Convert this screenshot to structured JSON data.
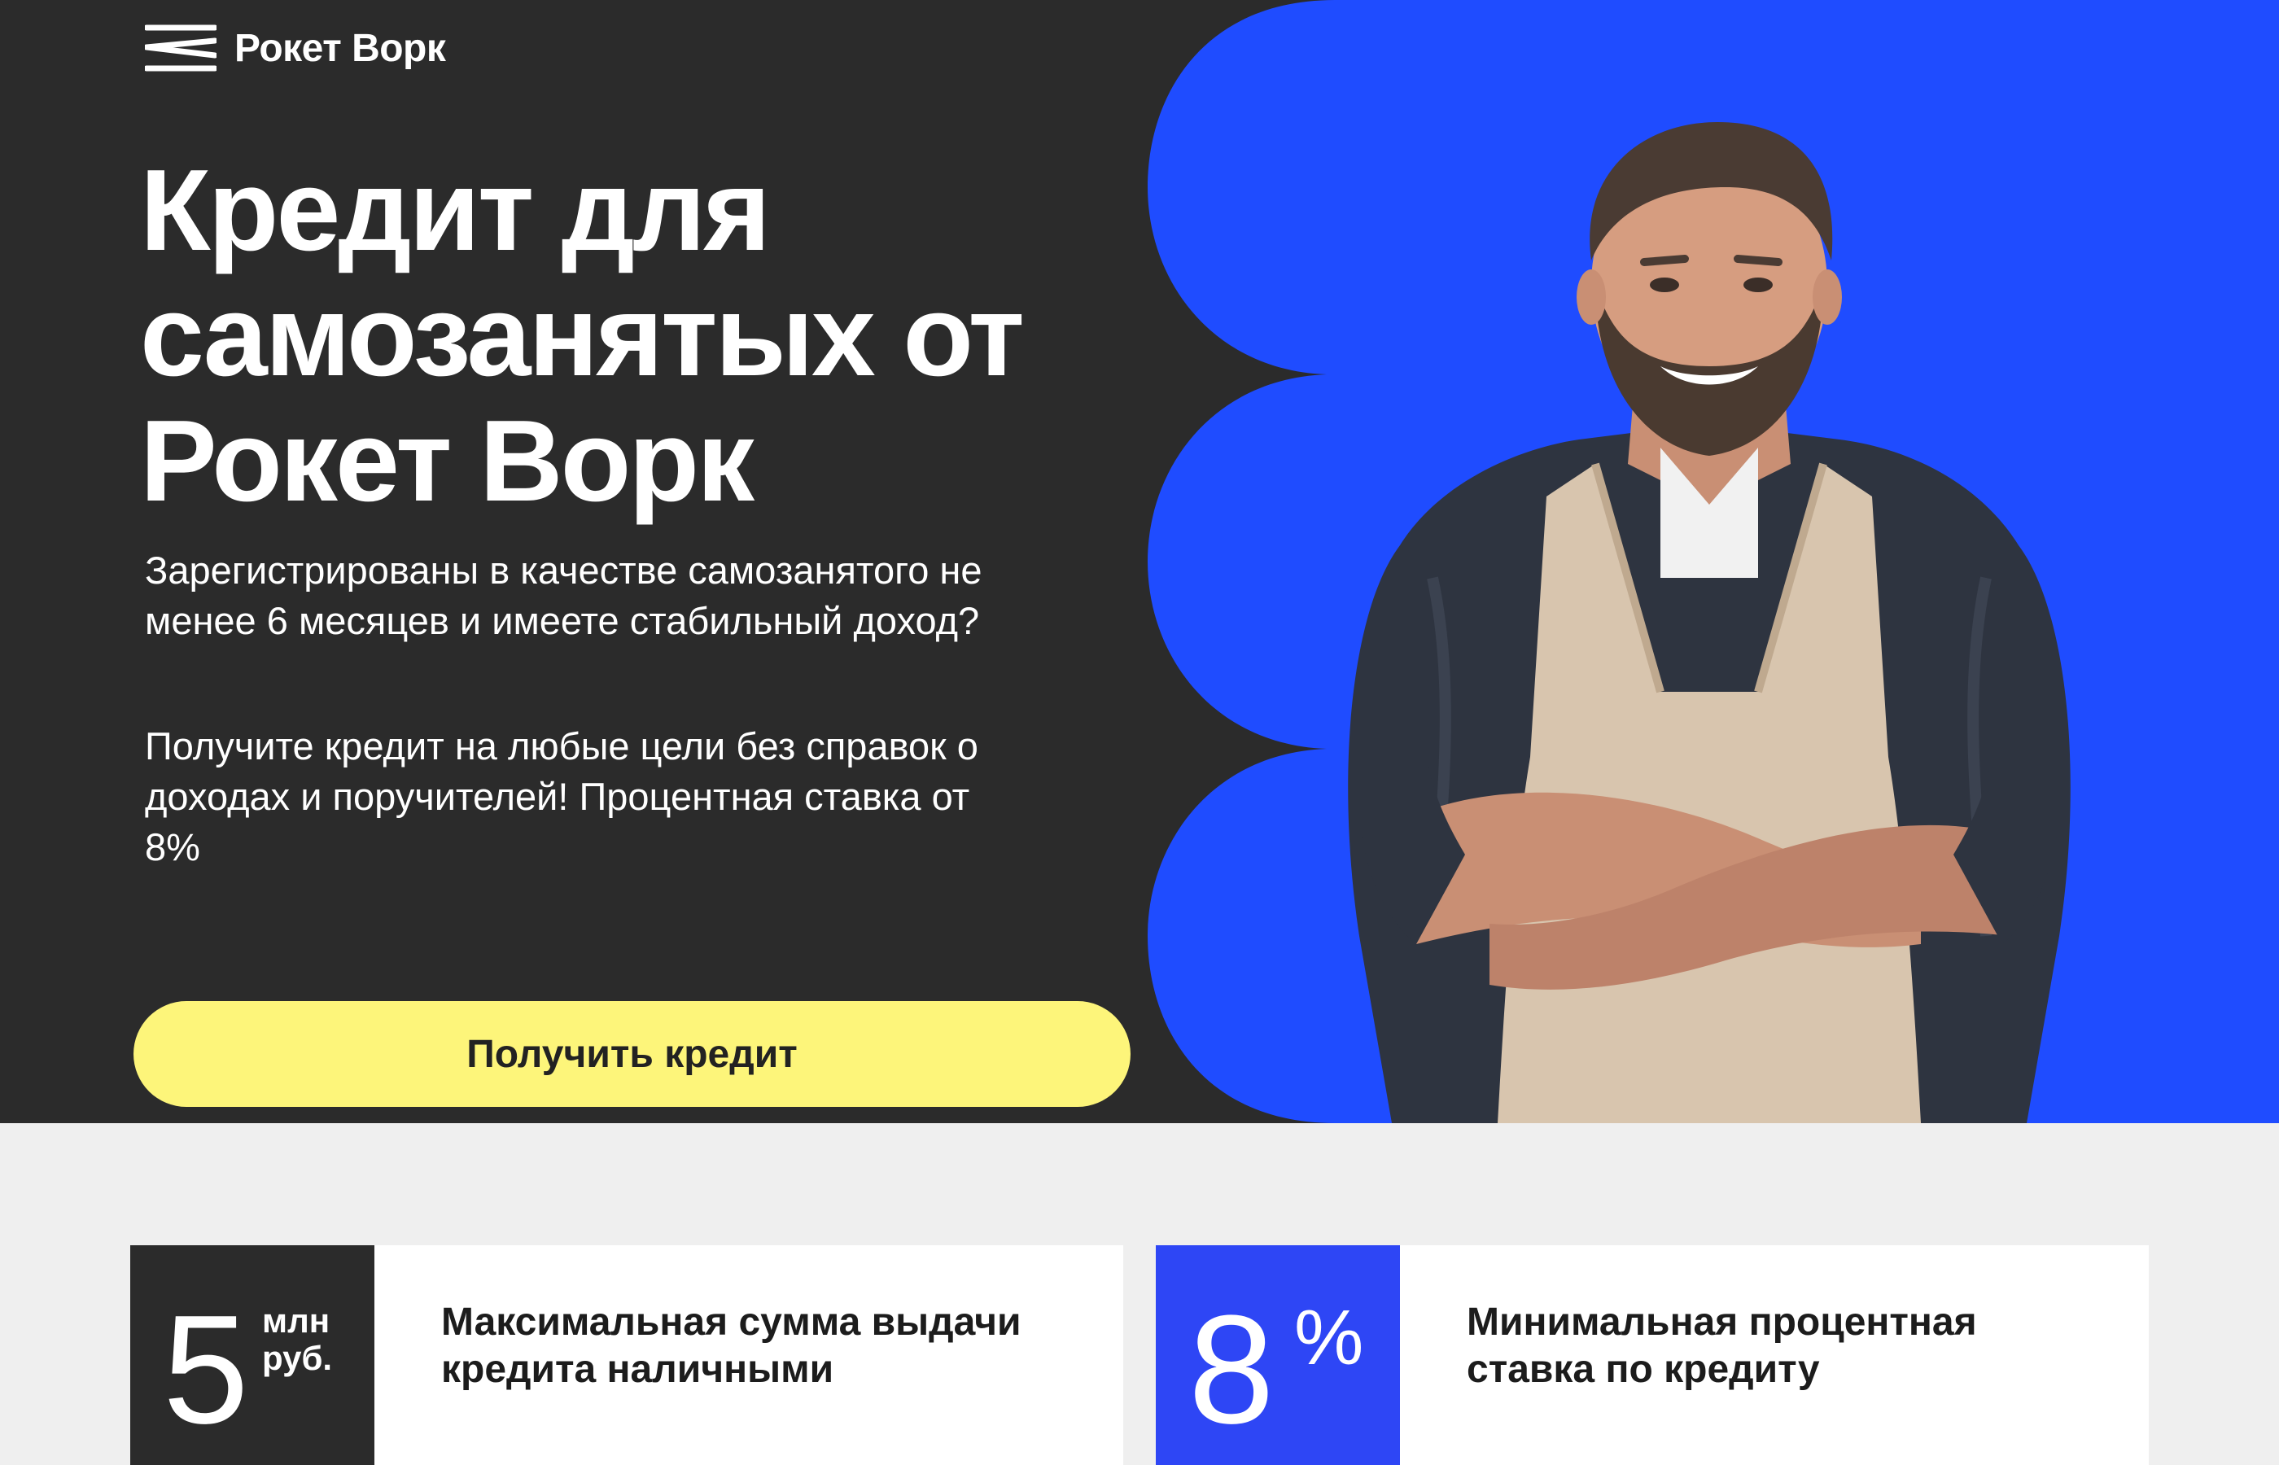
{
  "brand": {
    "name": "Рокет Ворк",
    "logo_icon": "rocketwork-logo-icon"
  },
  "hero": {
    "headline": "Кредит для самозанятых от Рокет Ворк",
    "paragraph1": "Зарегистрированы в качестве самозанятого не менее 6 месяцев и имеете стабильный доход?",
    "paragraph2": "Получите кредит на любые цели без справок о доходах и поручителей! Процентная ставка от 8%",
    "cta_label": "Получить кредит"
  },
  "features": [
    {
      "value": "5",
      "unit_line1": "млн",
      "unit_line2": "руб.",
      "text": "Максимальная сумма выдачи кредита наличными"
    },
    {
      "value": "8",
      "suffix": "%",
      "text": "Минимальная процентная ставка по кредиту"
    }
  ],
  "colors": {
    "dark_bg": "#2b2b2b",
    "blue_accent": "#1f4cff",
    "badge_blue": "#2e46f5",
    "cta_yellow": "#fdf57a",
    "page_bg": "#efefef"
  }
}
